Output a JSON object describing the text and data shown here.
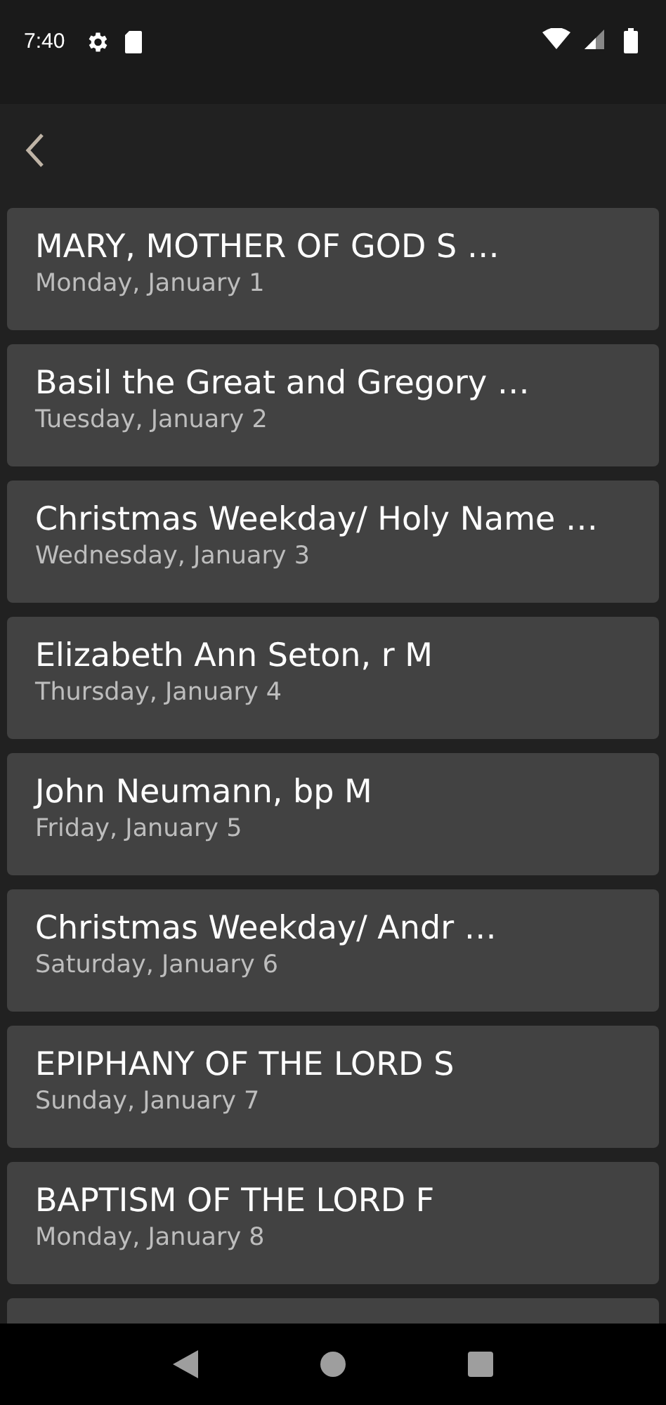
{
  "status_bar": {
    "time": "7:40"
  },
  "items": [
    {
      "kind": "entry",
      "title": "MARY, MOTHER OF GOD S …",
      "date": "Monday, January 1"
    },
    {
      "kind": "entry",
      "title": "Basil the Great and Gregory …",
      "date": "Tuesday, January 2"
    },
    {
      "kind": "entry",
      "title": "Christmas Weekday/ Holy Name …",
      "date": "Wednesday, January 3"
    },
    {
      "kind": "entry",
      "title": "Elizabeth Ann Seton, r M",
      "date": "Thursday, January 4"
    },
    {
      "kind": "entry",
      "title": "John Neumann, bp M",
      "date": "Friday, January 5"
    },
    {
      "kind": "entry",
      "title": "Christmas Weekday/ Andr …",
      "date": "Saturday, January 6"
    },
    {
      "kind": "entry",
      "title": "EPIPHANY OF THE LORD S",
      "date": "Sunday, January 7"
    },
    {
      "kind": "entry",
      "title": "BAPTISM OF THE LORD F",
      "date": "Monday, January 8"
    },
    {
      "kind": "clipped"
    }
  ]
}
